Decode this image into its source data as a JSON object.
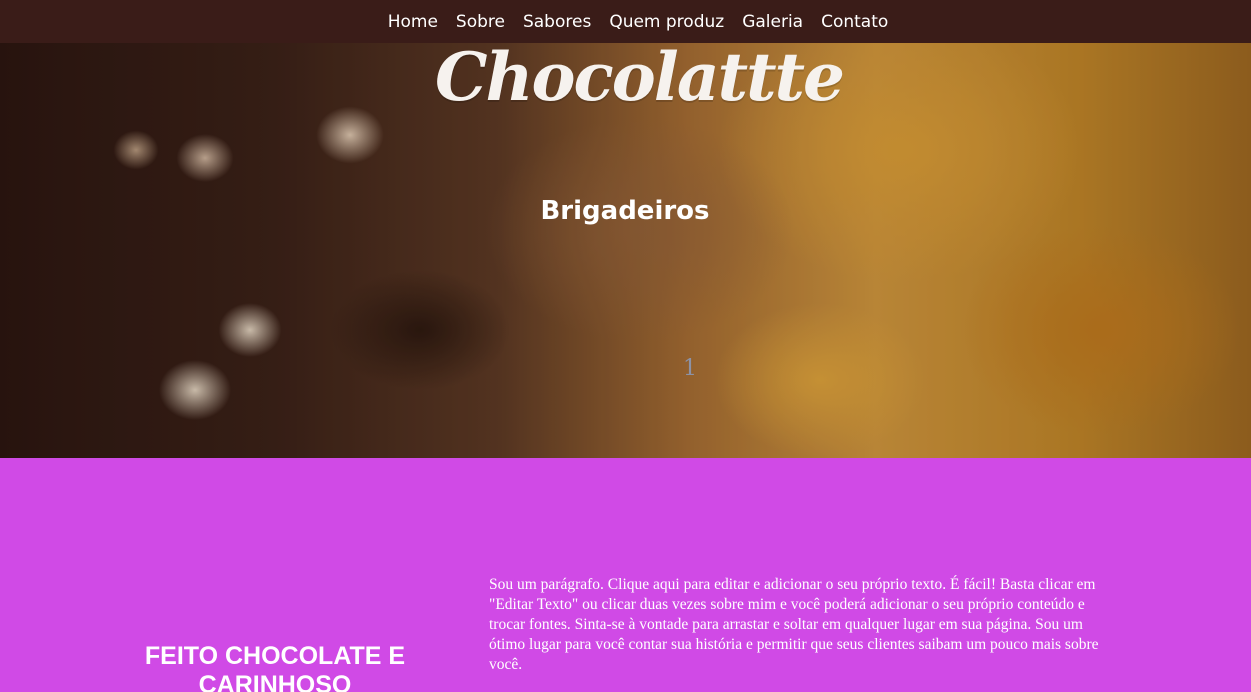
{
  "nav": {
    "items": [
      {
        "label": "Home"
      },
      {
        "label": "Sobre"
      },
      {
        "label": "Sabores"
      },
      {
        "label": "Quem produz"
      },
      {
        "label": "Galeria"
      },
      {
        "label": "Contato"
      }
    ]
  },
  "hero": {
    "logo_text": "Chocolattte",
    "slide_title": "Brigadeiros",
    "slide_counter": "1"
  },
  "about": {
    "heading": "FEITO CHOCOLATE E CARINHOSO",
    "paragraph": "Sou um parágrafo. Clique aqui para editar e adicionar o seu próprio texto. É fácil! Basta clicar em \"Editar Texto\" ou clicar duas vezes sobre mim e você poderá adicionar o seu próprio conteúdo e trocar fontes. Sinta-se à vontade para arrastar e soltar em qualquer lugar em sua página. Sou um ótimo lugar para você contar sua história e permitir que seus clientes saibam um pouco mais sobre você."
  },
  "colors": {
    "navbar_bg": "#3a1c18",
    "section_bg": "#d04ae6",
    "text": "#ffffff"
  }
}
